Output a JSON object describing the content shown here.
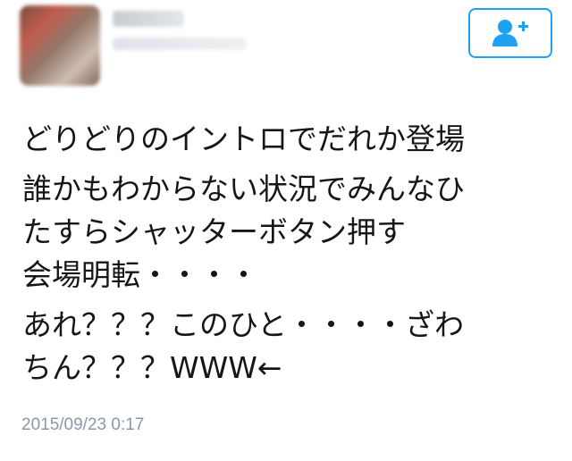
{
  "tweet": {
    "lines": [
      "どりどりのイントロでだれか登場",
      "誰かもわからない状況でみんなひ",
      "たすらシャッターボタン押す",
      "会場明転・・・・",
      "あれ？？？このひと・・・・ざわ",
      "ちん？？？WWW←"
    ],
    "timestamp": "2015/09/23 0:17"
  },
  "follow_button": {
    "icon": "add-user-icon"
  },
  "colors": {
    "accent": "#1da1f2",
    "text": "#14171a",
    "muted": "#8899a6"
  }
}
